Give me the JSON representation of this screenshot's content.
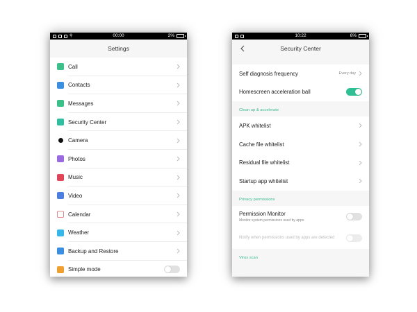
{
  "left": {
    "status": {
      "time": "00:00",
      "battery": "2%"
    },
    "title": "Settings",
    "items": [
      {
        "label": "Call",
        "icon": "phone-icon",
        "color": "#3cc08a",
        "control": "chevron"
      },
      {
        "label": "Contacts",
        "icon": "contacts-icon",
        "color": "#3a8fe0",
        "control": "chevron"
      },
      {
        "label": "Messages",
        "icon": "message-icon",
        "color": "#3cc08a",
        "control": "chevron"
      },
      {
        "label": "Security Center",
        "icon": "shield-icon",
        "color": "#2fbfa0",
        "control": "chevron"
      },
      {
        "label": "Camera",
        "icon": "camera-icon",
        "color": "#111111",
        "control": "chevron"
      },
      {
        "label": "Photos",
        "icon": "photos-icon",
        "color": "#9a6ae0",
        "control": "chevron"
      },
      {
        "label": "Music",
        "icon": "music-icon",
        "color": "#e0455a",
        "control": "chevron"
      },
      {
        "label": "Video",
        "icon": "video-icon",
        "color": "#4a7fe0",
        "control": "chevron"
      },
      {
        "label": "Calendar",
        "icon": "calendar-icon",
        "color": "#e08a8a",
        "control": "chevron"
      },
      {
        "label": "Weather",
        "icon": "weather-icon",
        "color": "#35b7e8",
        "control": "chevron"
      },
      {
        "label": "Backup and Restore",
        "icon": "backup-icon",
        "color": "#3a8fe0",
        "control": "chevron"
      },
      {
        "label": "Simple mode",
        "icon": "simple-mode-icon",
        "color": "#f0a030",
        "control": "toggle-off"
      }
    ]
  },
  "right": {
    "status": {
      "time": "10:22",
      "battery": "6%"
    },
    "title": "Security Center",
    "self_diagnosis": {
      "label": "Self diagnosis frequency",
      "value": "Every day"
    },
    "homescreen_ball": {
      "label": "Homescreen acceleration ball",
      "on": true
    },
    "section_cleanup": "Clean up & accelerate",
    "cleanup_items": [
      {
        "label": "APK whitelist"
      },
      {
        "label": "Cache file whitelist"
      },
      {
        "label": "Residual file whitelist"
      },
      {
        "label": "Startup app whitelist"
      }
    ],
    "section_privacy": "Privacy permissions",
    "permission_monitor": {
      "label": "Permission Monitor",
      "sub": "Monitor system permissions used by apps",
      "on": false
    },
    "notify": {
      "label": "Notify when permissions used by apps are detected",
      "on": false
    },
    "section_virus": "Virus scan"
  },
  "colors": {
    "accent": "#2fbf95",
    "section": "#39b991"
  }
}
